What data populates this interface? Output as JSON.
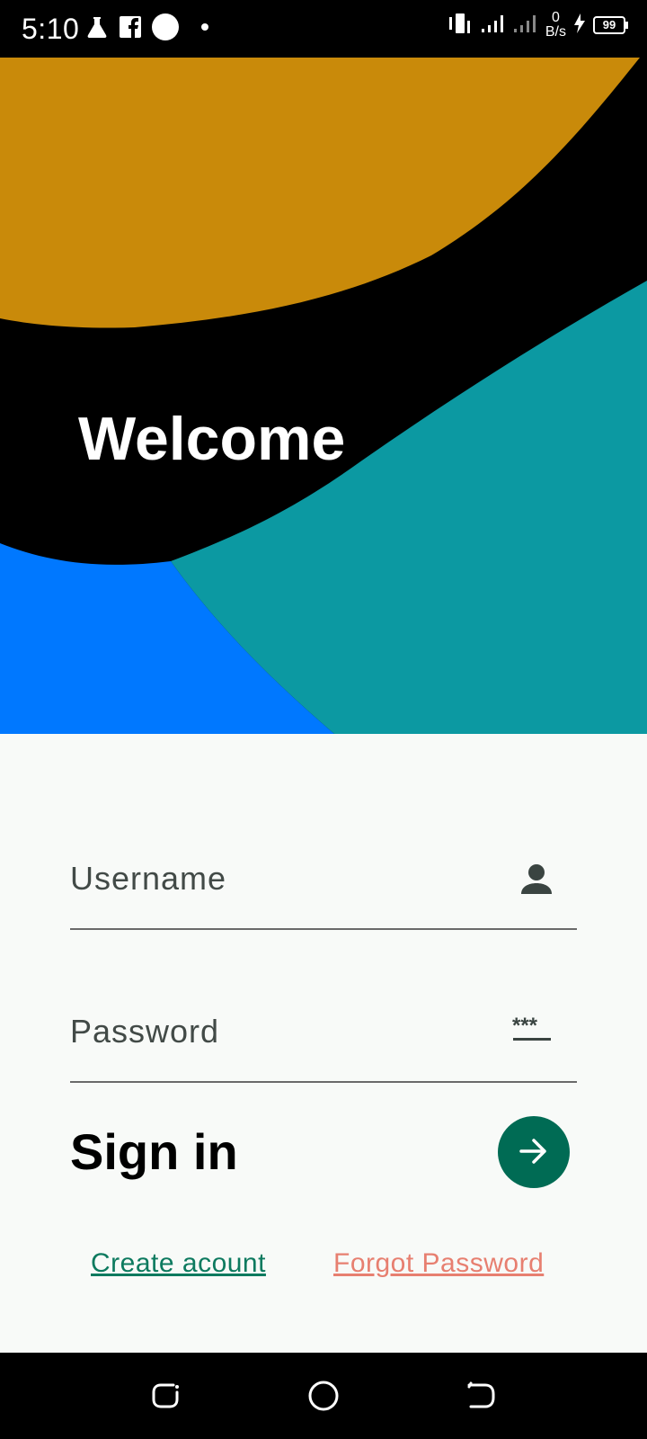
{
  "status_bar": {
    "time": "5:10",
    "network_speed_value": "0",
    "network_speed_unit": "B/s",
    "battery": "99",
    "icons": [
      "lab-flask-icon",
      "facebook-icon",
      "circle-notification-icon",
      "dot-icon",
      "vibrate-icon",
      "signal-icon",
      "signal-weak-icon",
      "charging-icon",
      "battery-icon"
    ]
  },
  "hero": {
    "title": "Welcome",
    "colors": {
      "top_band": "#c98a0a",
      "middle_band": "#000000",
      "right_band": "#0c99a2",
      "bottom_left": "#0078ff"
    }
  },
  "form": {
    "username": {
      "placeholder": "Username",
      "icon": "person-icon"
    },
    "password": {
      "placeholder": "Password",
      "icon": "password-dots-icon"
    },
    "submit_heading": "Sign in",
    "submit_icon": "arrow-right-icon"
  },
  "links": {
    "create_account": "Create acount",
    "forgot_password": "Forgot Password"
  },
  "nav_bar": {
    "buttons": [
      "recents-icon",
      "home-icon",
      "back-icon"
    ]
  },
  "theme": {
    "primary": "#006b54",
    "create_link_color": "#0d7a5f",
    "forgot_link_color": "#e77f70",
    "background": "#f8faf8"
  }
}
